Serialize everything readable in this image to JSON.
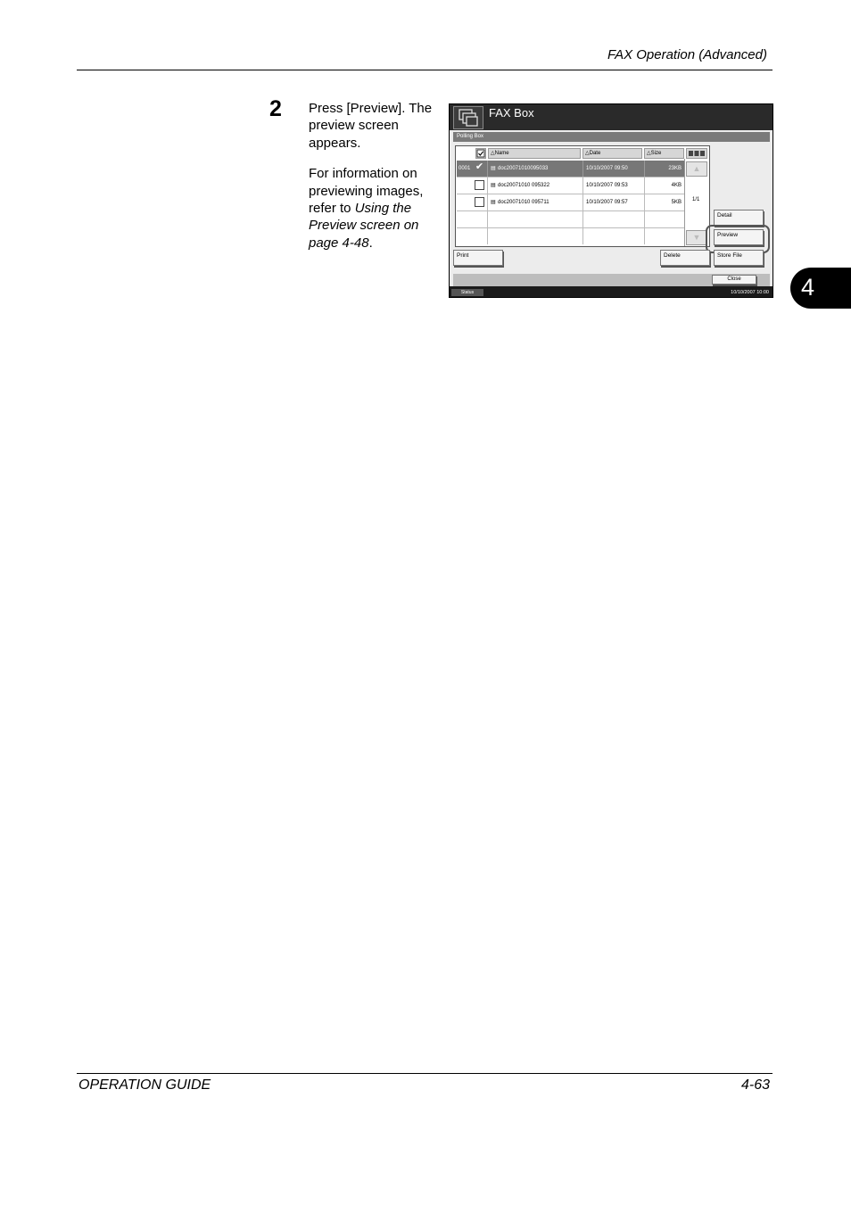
{
  "header": {
    "section_title": "FAX Operation (Advanced)"
  },
  "footer": {
    "guide_name": "OPERATION GUIDE",
    "page_number": "4-63"
  },
  "chapter_tab": {
    "number": "4"
  },
  "step": {
    "number": "2",
    "paragraph1": "Press [Preview]. The preview screen appears.",
    "paragraph2_prefix": "For information on previewing images, refer to ",
    "paragraph2_link": "Using the Preview screen on page 4-48",
    "paragraph2_suffix": "."
  },
  "screen": {
    "title": "FAX Box",
    "subtitle": "Polling Box",
    "columns": {
      "name": "Name",
      "date": "Date",
      "size": "Size"
    },
    "rows": [
      {
        "num": "0001",
        "checked": true,
        "name": "doc20071010095033",
        "date": "10/10/2007 09:50",
        "size": "23KB"
      },
      {
        "num": "",
        "checked": false,
        "name": "doc20071010 095322",
        "date": "10/10/2007 09:53",
        "size": "4KB"
      },
      {
        "num": "",
        "checked": false,
        "name": "doc20071010 095711",
        "date": "10/10/2007 09:57",
        "size": "5KB"
      }
    ],
    "page_indicator": "1/1",
    "buttons": {
      "detail": "Detail",
      "preview": "Preview",
      "print": "Print",
      "delete": "Delete",
      "store_file": "Store File",
      "close": "Close"
    },
    "status_label": "Status",
    "datetime": "10/10/2007 10:00"
  }
}
